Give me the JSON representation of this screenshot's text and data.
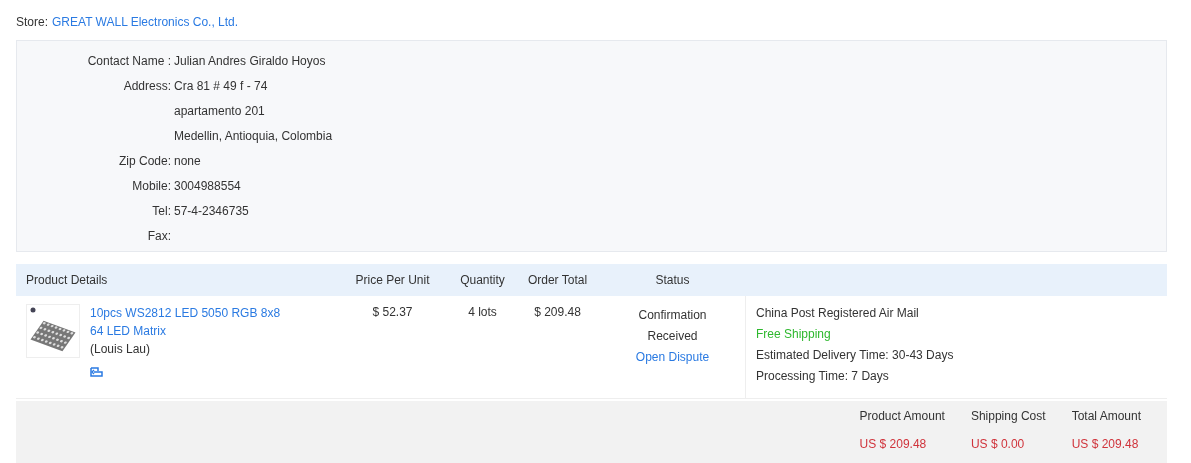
{
  "store": {
    "label": "Store:",
    "name": "GREAT WALL Electronics Co., Ltd."
  },
  "contact": [
    {
      "label": "Contact Name :",
      "lines": [
        "Julian Andres Giraldo Hoyos"
      ]
    },
    {
      "label": "Address:",
      "lines": [
        "Cra 81 # 49 f - 74",
        "apartamento 201",
        "Medellin, Antioquia, Colombia"
      ]
    },
    {
      "label": "Zip Code:",
      "lines": [
        "none"
      ]
    },
    {
      "label": "Mobile:",
      "lines": [
        "3004988554"
      ]
    },
    {
      "label": "Tel:",
      "lines": [
        "57-4-2346735"
      ]
    },
    {
      "label": "Fax:"
    }
  ],
  "table": {
    "columns": [
      "Product Details",
      "Price Per Unit",
      "Quantity",
      "Order Total",
      "Status"
    ],
    "rows": [
      {
        "product": "10pcs WS2812 LED 5050 RGB 8x8 64 LED Matrix",
        "seller": "(Louis Lau)",
        "price": "$ 52.37",
        "quantity": "4 lots",
        "total": "$ 209.48",
        "status": "Confirmation Received",
        "action": "Open Dispute",
        "shipping": [
          {
            "kind": "plain",
            "text": "China Post Registered Air Mail"
          },
          {
            "kind": "free",
            "text": "Free Shipping"
          },
          {
            "kind": "plain",
            "text": "Estimated Delivery Time: 30-43 Days"
          },
          {
            "kind": "plain",
            "text": "Processing Time: 7 Days"
          }
        ]
      }
    ]
  },
  "summary": [
    {
      "label": "Product Amount",
      "value": "US $ 209.48"
    },
    {
      "label": "Shipping Cost",
      "value": "US $ 0.00"
    },
    {
      "label": "Total Amount",
      "value": "US $ 209.48"
    }
  ]
}
